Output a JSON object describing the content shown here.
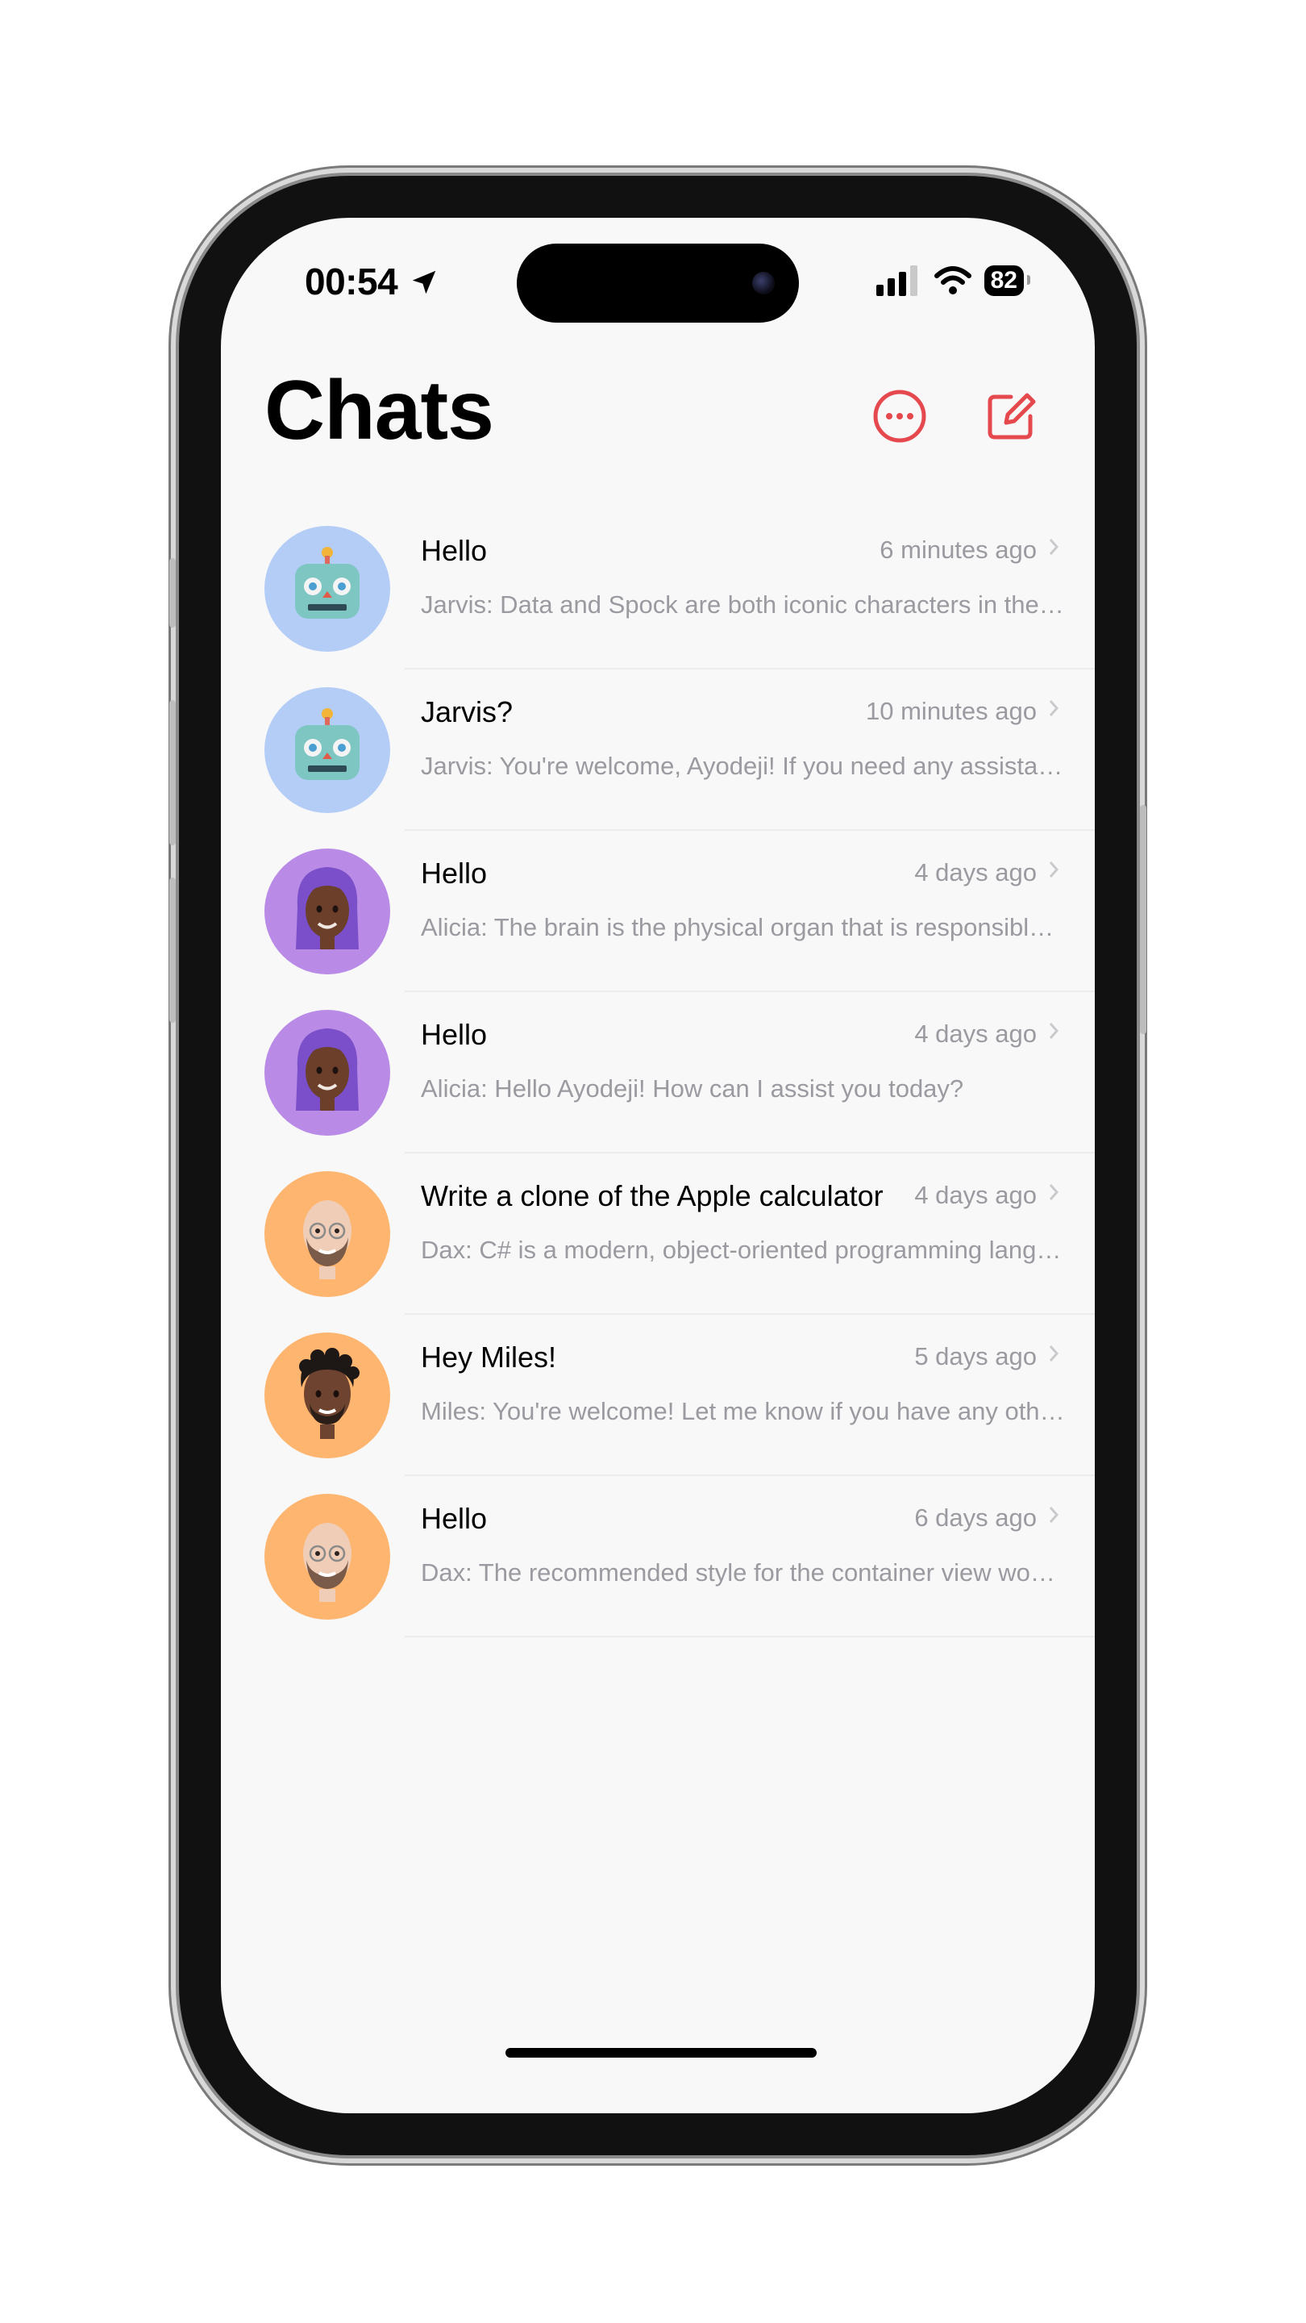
{
  "status_bar": {
    "time": "00:54",
    "battery": "82"
  },
  "header": {
    "title": "Chats",
    "more_icon": "ellipsis-circle-icon",
    "compose_icon": "square-pencil-icon"
  },
  "colors": {
    "accent": "#e5484d",
    "robot_bg": "#b3cdf7",
    "alicia_bg": "#b98be6",
    "dax_bg": "#fdb56f"
  },
  "chats": [
    {
      "title": "Hello",
      "time": "6 minutes ago",
      "preview": "Jarvis: Data and Spock are both iconic characters in the Star Trek franchise",
      "avatar": "robot"
    },
    {
      "title": "Jarvis?",
      "time": "10 minutes ago",
      "preview": "Jarvis: You're welcome, Ayodeji! If you need any assistance",
      "avatar": "robot"
    },
    {
      "title": "Hello",
      "time": "4 days ago",
      "preview": "Alicia: The brain is the physical organ that is responsible for",
      "avatar": "alicia"
    },
    {
      "title": "Hello",
      "time": "4 days ago",
      "preview": "Alicia: Hello Ayodeji! How can I assist you today?",
      "avatar": "alicia"
    },
    {
      "title": "Write a clone of the Apple calculator",
      "time": "4 days ago",
      "preview": "Dax: C# is a modern, object-oriented programming language",
      "avatar": "dax"
    },
    {
      "title": "Hey Miles!",
      "time": "5 days ago",
      "preview": "Miles: You're welcome! Let me know if you have any other questions",
      "avatar": "miles"
    },
    {
      "title": "Hello",
      "time": "6 days ago",
      "preview": "Dax: The recommended style for the container view would be",
      "avatar": "dax"
    }
  ]
}
